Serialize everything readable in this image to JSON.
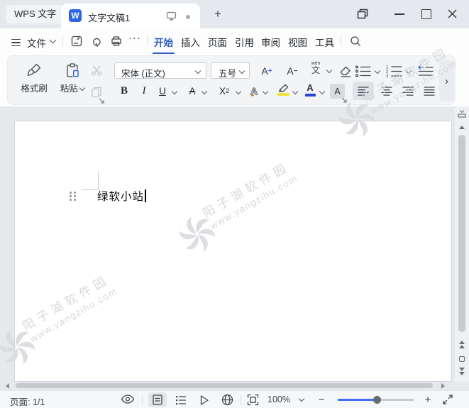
{
  "tabbar": {
    "app_button_label": "WPS 文字",
    "doc_icon_letter": "W",
    "doc_tab_title": "文字文稿1",
    "new_tab_label": "+"
  },
  "menubar": {
    "file_label": "文件",
    "more_label": "···",
    "active_tab": "开始",
    "tabs": [
      {
        "label": "开始"
      },
      {
        "label": "插入"
      },
      {
        "label": "页面"
      },
      {
        "label": "引用"
      },
      {
        "label": "审阅"
      },
      {
        "label": "视图"
      },
      {
        "label": "工具"
      }
    ]
  },
  "ribbon": {
    "format_painter_label": "格式刷",
    "paste_label": "粘贴",
    "font_name": "宋体 (正文)",
    "font_size": "五号",
    "bold": "B",
    "italic": "I",
    "underline": "U",
    "strikethrough_letter": "A",
    "superscript_base": "X",
    "superscript_exp": "2",
    "grow_letter": "A",
    "grow_sign": "+",
    "shrink_letter": "A",
    "shrink_sign": "−",
    "pinyin_char": "文",
    "pinyin_annotation": "wén",
    "effects_letter": "A",
    "font_color_letter": "A",
    "shading_letter": "A",
    "expand_chevron": "›"
  },
  "document": {
    "paragraph_text": "绿软小站"
  },
  "statusbar": {
    "page_indicator": "页面: 1/1",
    "zoom_value": "100%",
    "zoom_out": "−",
    "zoom_in": "+"
  },
  "watermark": {
    "line1": "阳子湖软件园",
    "line2": "www.yangzihu.com"
  },
  "colors": {
    "accent_blue": "#2a5cc5",
    "doc_icon_blue": "#2d65e4",
    "highlight_yellow": "#f2e239",
    "font_color_bar": "#2c45d8",
    "slider_fill": "#3d6ef5"
  }
}
